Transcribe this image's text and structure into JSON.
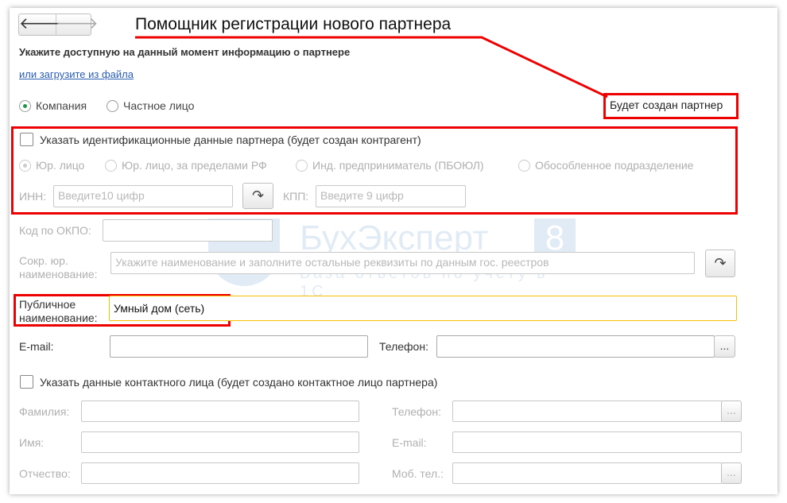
{
  "title": "Помощник регистрации нового партнера",
  "subtitle": "Укажите доступную на данный момент информацию о партнере",
  "load_link": "или загрузите из файла",
  "partner_type": {
    "options": [
      "Компания",
      "Частное лицо"
    ],
    "selected": "Компания"
  },
  "will_create": "Будет создан партнер",
  "ident": {
    "checkbox_label": "Указать идентификационные данные партнера (будет создан контрагент)",
    "checked": false,
    "kinds": [
      "Юр. лицо",
      "Юр. лицо, за пределами РФ",
      "Инд. предприниматель (ПБОЮЛ)",
      "Обособленное подразделение"
    ],
    "selected_kind": "Юр. лицо",
    "inn_label": "ИНН:",
    "inn_placeholder": "Введите10 цифр",
    "kpp_label": "КПП:",
    "kpp_placeholder": "Введите 9 цифр"
  },
  "okpo_label": "Код по ОКПО:",
  "short_name_label1": "Сокр. юр.",
  "short_name_label2": "наименование:",
  "short_name_placeholder": "Укажите наименование и заполните остальные реквизиты по данным гос. реестров",
  "public_name_label1": "Публичное",
  "public_name_label2": "наименование:",
  "public_name_value": "Умный дом (сеть)",
  "email_label": "E-mail:",
  "phone_label": "Телефон:",
  "more_btn": "...",
  "contact": {
    "checkbox_label": "Указать данные контактного лица (будет создано контактное лицо партнера)",
    "checked": false,
    "last_name": "Фамилия:",
    "first_name": "Имя:",
    "middle_name": "Отчество:",
    "phone": "Телефон:",
    "email": "E-mail:",
    "mobile": "Моб. тел.:"
  },
  "watermark": {
    "brand": "БухЭксперт",
    "num": "8",
    "tagline": "База ответов по учету в 1С"
  },
  "colors": {
    "annotation": "#e00000",
    "accent_focus": "#f5c000",
    "radio": "#1a9a48",
    "link": "#2a5db0"
  }
}
